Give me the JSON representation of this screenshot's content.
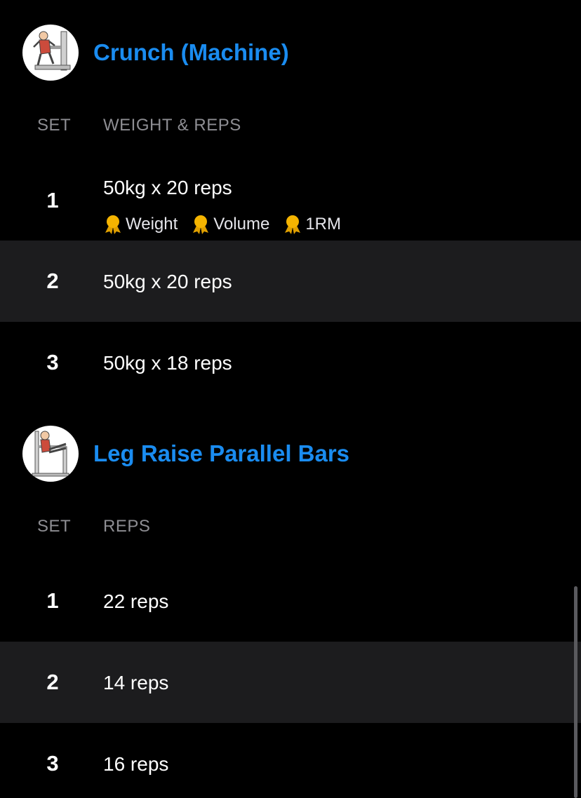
{
  "exercises": [
    {
      "title": "Crunch (Machine)",
      "image_icon": "crunch-machine-illustration",
      "headers": {
        "set": "SET",
        "value": "WEIGHT & REPS"
      },
      "sets": [
        {
          "number": "1",
          "value": "50kg x 20 reps",
          "records": [
            "Weight",
            "Volume",
            "1RM"
          ]
        },
        {
          "number": "2",
          "value": "50kg x 20 reps"
        },
        {
          "number": "3",
          "value": "50kg x 18 reps"
        }
      ]
    },
    {
      "title": "Leg Raise Parallel Bars",
      "image_icon": "leg-raise-parallel-bars-illustration",
      "headers": {
        "set": "SET",
        "value": "REPS"
      },
      "sets": [
        {
          "number": "1",
          "value": "22 reps"
        },
        {
          "number": "2",
          "value": "14 reps"
        },
        {
          "number": "3",
          "value": "16 reps"
        }
      ]
    }
  ],
  "colors": {
    "background": "#000000",
    "title_accent": "#1a8cf0",
    "alt_row": "#1c1c1e",
    "header_text": "#8e8e93",
    "medal": "#f5b400"
  },
  "record_icon": "medal-icon"
}
